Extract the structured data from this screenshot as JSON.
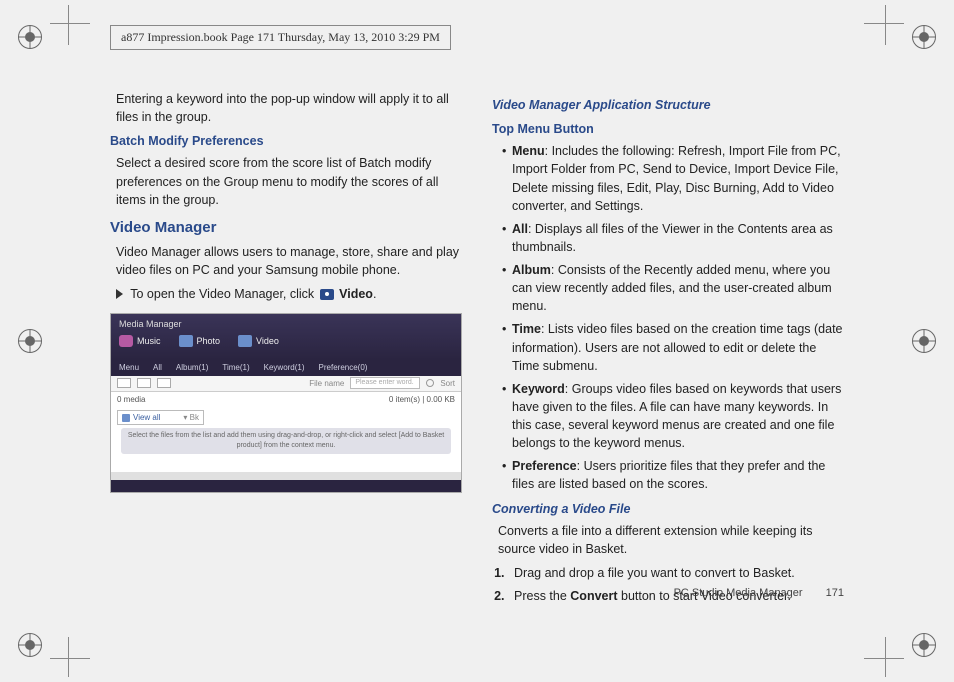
{
  "page_header": "a877 Impression.book  Page 171  Thursday, May 13, 2010  3:29 PM",
  "left": {
    "intro": "Entering a keyword into the pop-up window will apply it to all files in the group.",
    "batch_heading": "Batch Modify Preferences",
    "batch_body": "Select a desired score from the score list of Batch modify preferences on the Group menu to modify the scores of all items in the group.",
    "vm_heading": "Video Manager",
    "vm_body": "Video Manager allows users to manage, store, share and play video files on PC and your Samsung mobile phone.",
    "vm_open_prefix": "To open the Video Manager, click ",
    "vm_open_label": "Video",
    "vm_open_suffix": ".",
    "screenshot": {
      "title": "Media Manager",
      "tabs": {
        "music": "Music",
        "photo": "Photo",
        "video": "Video"
      },
      "menu2": [
        "Menu",
        "All",
        "Album(1)",
        "Time(1)",
        "Keyword(1)",
        "Preference(0)"
      ],
      "toolbar_hint1": "File name",
      "toolbar_hint2": "Please enter word.",
      "toolbar_sort": "Sort",
      "media_count": "0 media",
      "items_size": "0 item(s) | 0.00 KB",
      "view_all": "View all",
      "bk": "Bk",
      "hint": "Select the files from the list and add them using drag-and-drop, or right-click and select [Add to Basket product] from the context menu."
    }
  },
  "right": {
    "vmas_heading": "Video Manager Application Structure",
    "topmenu_heading": "Top Menu Button",
    "bullets": {
      "menu_label": "Menu",
      "menu_text": ": Includes the following: Refresh, Import File from PC, Import Folder from PC, Send to Device, Import Device File, Delete missing files, Edit, Play, Disc Burning, Add to Video converter, and Settings.",
      "all_label": "All",
      "all_text": ": Displays all files of the Viewer in the Contents area as thumbnails.",
      "album_label": "Album",
      "album_text": ": Consists of the Recently added menu, where you can view recently added files, and the user-created album menu.",
      "time_label": "Time",
      "time_text": ": Lists video files based on the creation time tags (date information). Users are not allowed to edit or delete the Time submenu.",
      "keyword_label": "Keyword",
      "keyword_text": ": Groups video files based on keywords that users have given to the files. A file can have many keywords. In this case, several keyword menus are created and one file belongs to the keyword menus.",
      "pref_label": "Preference",
      "pref_text": ": Users prioritize files that they prefer and the files are listed based on the scores."
    },
    "convert_heading": "Converting a Video File",
    "convert_body": "Converts a file into a different extension while keeping its source video in Basket.",
    "steps": {
      "s1": "Drag and drop a file you want to convert to Basket.",
      "s2_prefix": "Press the ",
      "s2_bold": "Convert",
      "s2_suffix": " button to start Video converter."
    }
  },
  "footer": {
    "section": "PC Studio Media Manager",
    "page": "171"
  }
}
